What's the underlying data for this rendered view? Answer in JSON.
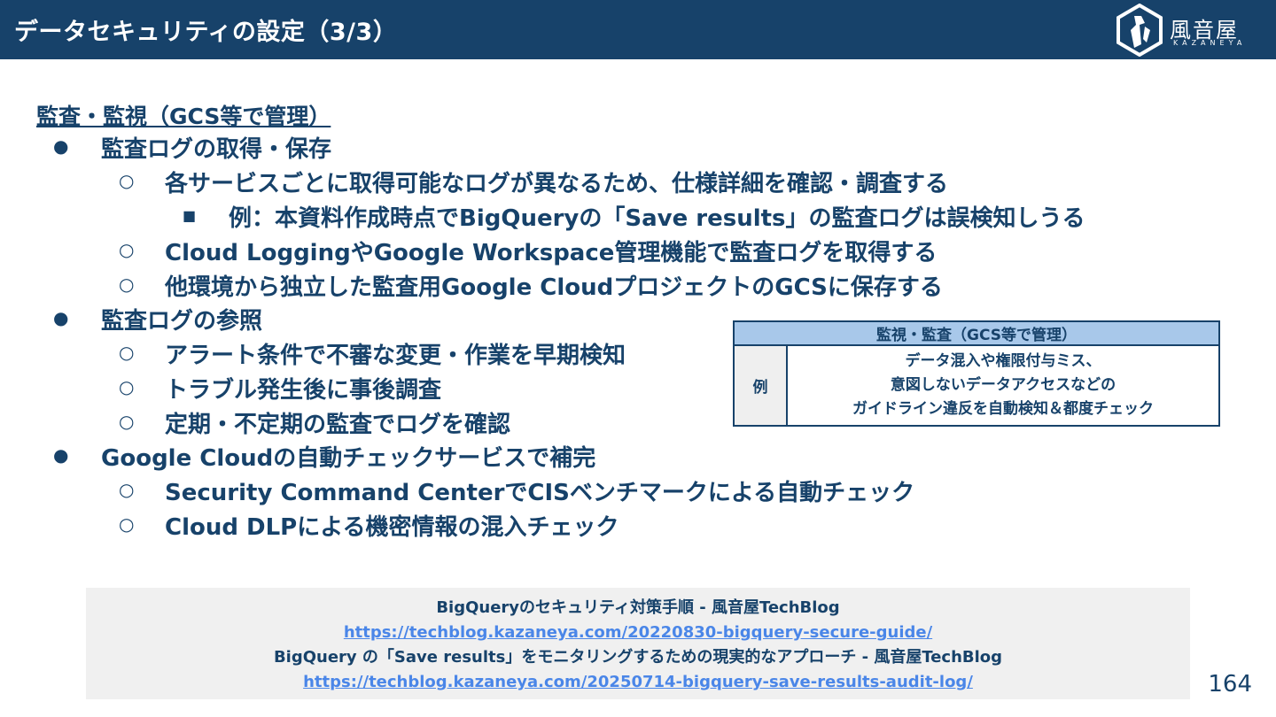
{
  "header": {
    "title": "データセキュリティの設定（3/3）",
    "logo_text": "風音屋",
    "logo_sub": "KAZANEYA"
  },
  "section_heading": "監査・監視（GCS等で管理）",
  "items": [
    {
      "level": 1,
      "bullet": "●",
      "text": "監査ログの取得・保存"
    },
    {
      "level": 2,
      "bullet": "○",
      "text": "各サービスごとに取得可能なログが異なるため、仕様詳細を確認・調査する"
    },
    {
      "level": 3,
      "bullet": "■",
      "text": "例：本資料作成時点でBigQueryの「Save results」の監査ログは誤検知しうる"
    },
    {
      "level": 2,
      "bullet": "○",
      "text": "Cloud LoggingやGoogle Workspace管理機能で監査ログを取得する"
    },
    {
      "level": 2,
      "bullet": "○",
      "text": "他環境から独立した監査用Google CloudプロジェクトのGCSに保存する"
    },
    {
      "level": 1,
      "bullet": "●",
      "text": "監査ログの参照"
    },
    {
      "level": 2,
      "bullet": "○",
      "text": "アラート条件で不審な変更・作業を早期検知"
    },
    {
      "level": 2,
      "bullet": "○",
      "text": "トラブル発生後に事後調査"
    },
    {
      "level": 2,
      "bullet": "○",
      "text": "定期・不定期の監査でログを確認"
    },
    {
      "level": 1,
      "bullet": "●",
      "text": "Google Cloudの自動チェックサービスで補完"
    },
    {
      "level": 2,
      "bullet": "○",
      "text": "Security Command CenterでCISベンチマークによる自動チェック"
    },
    {
      "level": 2,
      "bullet": "○",
      "text": "Cloud DLPによる機密情報の混入チェック"
    }
  ],
  "table": {
    "header": "監視・監査（GCS等で管理）",
    "row_label": "例",
    "row_lines": [
      "データ混入や権限付与ミス、",
      "意図しないデータアクセスなどの",
      "ガイドライン違反を自動検知＆都度チェック"
    ]
  },
  "references": [
    {
      "title": "BigQueryのセキュリティ対策手順 - 風音屋TechBlog",
      "url": "https://techblog.kazaneya.com/20220830-bigquery-secure-guide/"
    },
    {
      "title": "BigQuery の「Save results」をモニタリングするための現実的なアプローチ - 風音屋TechBlog",
      "url": "https://techblog.kazaneya.com/20250714-bigquery-save-results-audit-log/"
    }
  ],
  "page_number": "164",
  "colors": {
    "header_bg": "#17426a",
    "text": "#17426a",
    "table_header_bg": "#a8c8ea",
    "link": "#4a86e8",
    "ref_bg": "#f0f0f0"
  }
}
